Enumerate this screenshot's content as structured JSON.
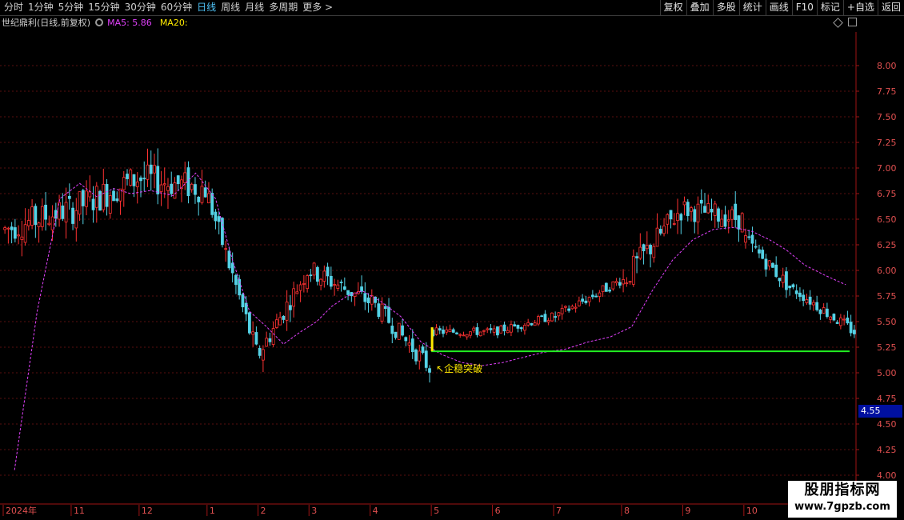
{
  "toolbar": {
    "tabs": [
      "分时",
      "1分钟",
      "5分钟",
      "15分钟",
      "30分钟",
      "60分钟",
      "日线",
      "周线",
      "月线",
      "多周期",
      "更多 >"
    ],
    "active_tab": "日线",
    "tools": [
      "复权",
      "叠加",
      "多股",
      "统计",
      "画线",
      "F10",
      "标记",
      "+自选",
      "返回"
    ]
  },
  "info": {
    "stock": "世纪鼎利(日线,前复权)",
    "ma5": "MA5: 5.86",
    "ma20": "MA20:"
  },
  "price_flag": "4.55",
  "annotation": "↖企稳突破",
  "watermark": {
    "line1": "股朋指标网",
    "line2": "www.7gpzb.com"
  },
  "colors": {
    "up": "#ff3232",
    "down": "#54d2e6",
    "ma5": "#e040fb",
    "support": "#22ee22",
    "marker": "#ffea00",
    "axis": "#a01414"
  },
  "chart_data": {
    "type": "candlestick",
    "ylim": [
      4.0,
      8.25
    ],
    "y_ticks": [
      "8.00",
      "7.75",
      "7.50",
      "7.25",
      "7.00",
      "6.75",
      "6.50",
      "6.25",
      "6.00",
      "5.75",
      "5.50",
      "5.25",
      "5.00",
      "4.75",
      "4.50",
      "4.25",
      "4.00"
    ],
    "x_labels": [
      "2024年",
      "11",
      "12",
      "1",
      "2",
      "3",
      "4",
      "5",
      "6",
      "7",
      "8",
      "9",
      "10",
      "11"
    ],
    "support_level": 5.21,
    "support_start_month": "5",
    "segments": [
      {
        "label": "10",
        "n": 20,
        "start": 6.4,
        "end": 6.6,
        "vol": 0.28
      },
      {
        "label": "11",
        "n": 20,
        "start": 6.6,
        "end": 6.9,
        "vol": 0.3
      },
      {
        "label": "12",
        "n": 20,
        "start": 6.9,
        "end": 6.8,
        "vol": 0.3
      },
      {
        "label": "1",
        "n": 15,
        "start": 6.7,
        "end": 5.2,
        "vol": 0.22
      },
      {
        "label": "2",
        "n": 15,
        "start": 5.2,
        "end": 6.0,
        "vol": 0.2
      },
      {
        "label": "3",
        "n": 18,
        "start": 6.0,
        "end": 5.7,
        "vol": 0.2
      },
      {
        "label": "4",
        "n": 18,
        "start": 5.7,
        "end": 5.05,
        "vol": 0.18
      },
      {
        "label": "5",
        "n": 18,
        "start": 5.4,
        "end": 5.4,
        "vol": 0.08
      },
      {
        "label": "6",
        "n": 18,
        "start": 5.4,
        "end": 5.55,
        "vol": 0.08
      },
      {
        "label": "7",
        "n": 20,
        "start": 5.55,
        "end": 5.9,
        "vol": 0.1
      },
      {
        "label": "8",
        "n": 18,
        "start": 5.9,
        "end": 6.6,
        "vol": 0.25
      },
      {
        "label": "9",
        "n": 18,
        "start": 6.6,
        "end": 6.5,
        "vol": 0.22
      },
      {
        "label": "10",
        "n": 15,
        "start": 6.3,
        "end": 5.8,
        "vol": 0.15
      },
      {
        "label": "11",
        "n": 18,
        "start": 5.8,
        "end": 5.4,
        "vol": 0.12
      }
    ],
    "ma20_series": [
      {
        "month": "10",
        "values": [
          4.05,
          5.6,
          6.7
        ]
      },
      {
        "month": "11",
        "values": [
          6.85,
          6.72,
          6.8,
          6.75
        ]
      },
      {
        "month": "12",
        "values": [
          6.78,
          6.73,
          6.95
        ]
      },
      {
        "month": "1",
        "values": [
          6.7,
          6.1,
          5.6
        ]
      },
      {
        "month": "2",
        "values": [
          5.45,
          5.28,
          5.4
        ]
      },
      {
        "month": "3",
        "values": [
          5.5,
          5.65,
          5.75,
          5.8
        ]
      },
      {
        "month": "4",
        "values": [
          5.7,
          5.55,
          5.3
        ]
      },
      {
        "month": "5",
        "values": [
          5.18,
          5.1,
          5.07
        ]
      },
      {
        "month": "6",
        "values": [
          5.1,
          5.15,
          5.2
        ]
      },
      {
        "month": "7",
        "values": [
          5.23,
          5.3,
          5.35
        ]
      },
      {
        "month": "8",
        "values": [
          5.45,
          5.8,
          6.1
        ]
      },
      {
        "month": "9",
        "values": [
          6.3,
          6.4,
          6.42
        ]
      },
      {
        "month": "10",
        "values": [
          6.38,
          6.3,
          6.2
        ]
      },
      {
        "month": "11",
        "values": [
          6.05,
          5.95,
          5.86
        ]
      }
    ]
  }
}
